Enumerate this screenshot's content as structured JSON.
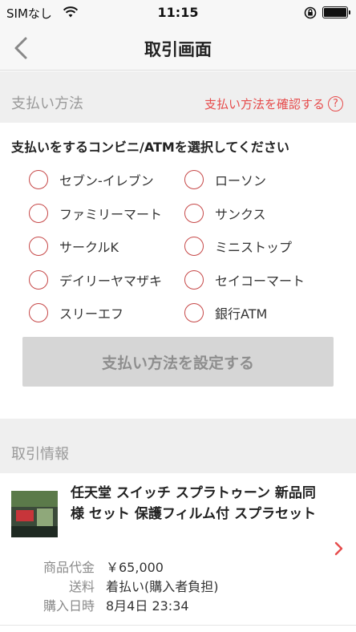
{
  "status": {
    "carrier": "SIMなし",
    "time": "11:15"
  },
  "nav": {
    "title": "取引画面"
  },
  "payment": {
    "section_title": "支払い方法",
    "confirm_link": "支払い方法を確認する",
    "help_glyph": "?",
    "prompt": "支払いをするコンビニ/ATMを選択してください",
    "options": [
      "セブン-イレブン",
      "ローソン",
      "ファミリーマート",
      "サンクス",
      "サークルK",
      "ミニストップ",
      "デイリーヤマザキ",
      "セイコーマート",
      "スリーエフ",
      "銀行ATM"
    ],
    "submit_label": "支払い方法を設定する"
  },
  "transaction": {
    "section_title": "取引情報",
    "item_title": "任天堂 スイッチ スプラトゥーン 新品同様 セット 保護フィルム付 スプラセット",
    "details": [
      {
        "label": "商品代金",
        "value": "￥65,000"
      },
      {
        "label": "送料",
        "value": "着払い(購入者負担)"
      },
      {
        "label": "購入日時",
        "value": "8月4日 23:34"
      }
    ]
  },
  "colors": {
    "accent_red": "#e64c4c",
    "radio_red": "#c64747",
    "disabled_button": "#d6d6d6"
  },
  "icons": [
    "wifi-icon",
    "rotation-lock-icon",
    "battery-icon",
    "back-chevron-icon",
    "help-icon",
    "chevron-right-icon"
  ]
}
